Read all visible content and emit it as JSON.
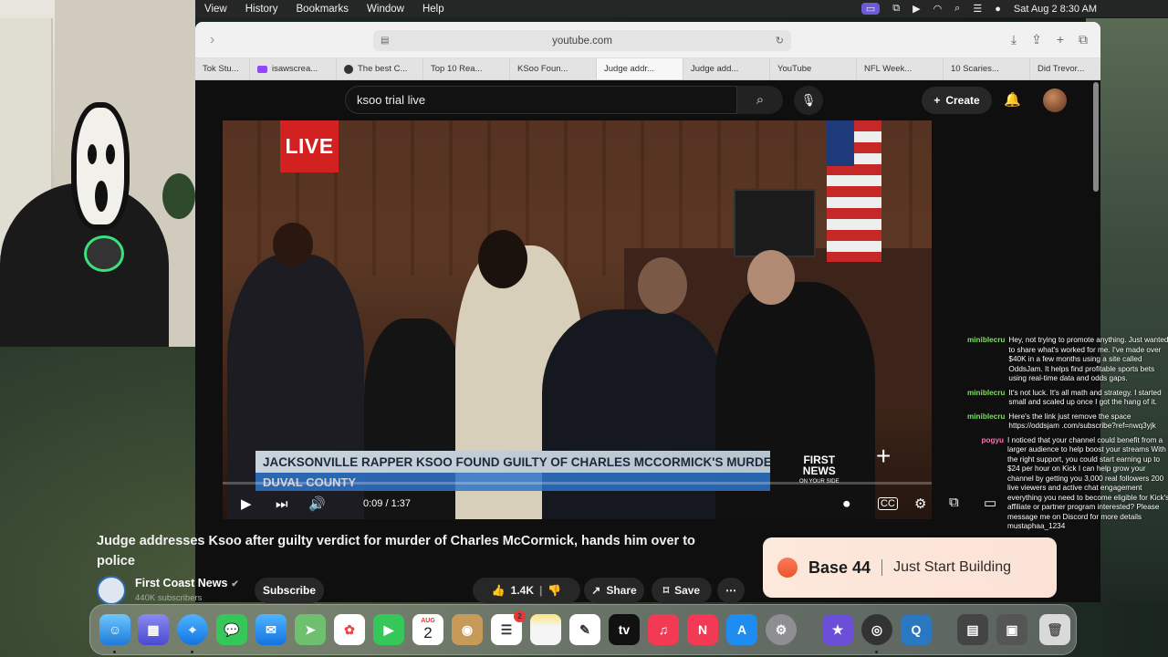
{
  "menubar": {
    "items": [
      "View",
      "History",
      "Bookmarks",
      "Window",
      "Help"
    ],
    "datetime": "Sat Aug 2  8:30 AM"
  },
  "browser": {
    "url": "youtube.com",
    "tabs": [
      "Tok Stu...",
      "isawscrea...",
      "The best C...",
      "Top 10 Rea...",
      "KSoo Foun...",
      "Judge addr...",
      "Judge add...",
      "YouTube",
      "NFL Week...",
      "10 Scaries...",
      "Did Trevor..."
    ]
  },
  "youtube": {
    "search_value": "ksoo trial live",
    "create_label": "Create",
    "video": {
      "live_badge": "LIVE",
      "chyron_main": "JACKSONVILLE RAPPER KSOO FOUND GUILTY OF CHARLES MCCORMICK'S MURDER",
      "chyron_sub": "DUVAL COUNTY",
      "news_logo_top": "FIRST",
      "news_logo_bottom": "NEWS",
      "news_logo_small": "ON YOUR SIDE",
      "time_display": "0:09 / 1:37",
      "progress_fraction": 0.0928
    },
    "title": "Judge addresses Ksoo after guilty verdict for murder of Charles McCormick, hands him over to police",
    "channel": {
      "name": "First Coast News",
      "subscribers": "440K subscribers",
      "subscribe_label": "Subscribe"
    },
    "actions": {
      "likes": "1.4K",
      "share_label": "Share",
      "save_label": "Save"
    },
    "ad": {
      "brand": "Base 44",
      "tagline": "Just Start Building"
    }
  },
  "chat": [
    {
      "user": "miniblecru",
      "color": "#7be05c",
      "text": "Hey, not trying to promote anything. Just wanted to share what's worked for me. I've made over $40K in a few months using a site called OddsJam. It helps find profitable sports bets using real-time data and odds gaps."
    },
    {
      "user": "miniblecru",
      "color": "#7be05c",
      "text": "It's not luck. It's all math and strategy. I started small and scaled up once I got the hang of it."
    },
    {
      "user": "miniblecru",
      "color": "#7be05c",
      "text": "Here's the link just remove the space https://oddsjam .com/subscribe?ref=nwq3yjk"
    },
    {
      "user": "pogyu",
      "color": "#ff6fae",
      "text": "I noticed that your channel could benefit from a larger audience to help boost your streams With the right support, you could start earning up to $24 per hour on Kick I can help grow your channel by getting you 3,000 real followers 200 live viewers and active chat engagement everything you need to become eligible for Kick's affiliate or partner program interested? Please message me on Discord for more details mustaphaa_1234"
    }
  ],
  "dock": {
    "calendar_month": "AUG",
    "calendar_day": "2",
    "reminders_badge": "2"
  },
  "colors": {
    "youtube_red": "#ff0000",
    "youtube_bg": "#0f0f0f",
    "live_red": "#d32020",
    "chyron_blue": "#2e74c9"
  }
}
